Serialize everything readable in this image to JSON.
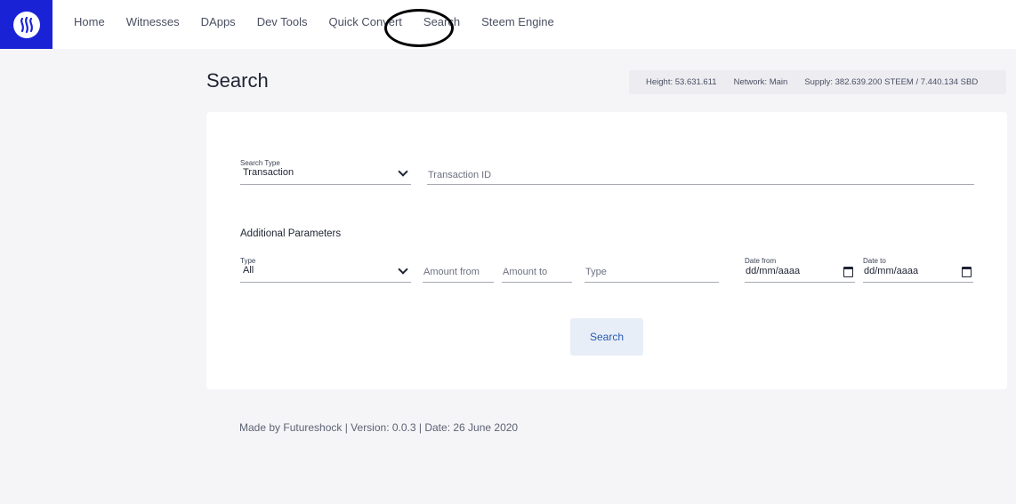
{
  "nav": {
    "items": [
      "Home",
      "Witnesses",
      "DApps",
      "Dev Tools",
      "Quick Convert",
      "Search",
      "Steem Engine"
    ],
    "active": "Search"
  },
  "page": {
    "title": "Search"
  },
  "stats": {
    "height": "Height: 53.631.611",
    "network": "Network: Main",
    "supply": "Supply: 382.639.200 STEEM / 7.440.134 SBD"
  },
  "form": {
    "search_type_label": "Search Type",
    "search_type_value": "Transaction",
    "transaction_id_placeholder": "Transaction ID",
    "additional_params_label": "Additional Parameters",
    "type_label": "Type",
    "type_value": "All",
    "amount_from_placeholder": "Amount from",
    "amount_to_placeholder": "Amount to",
    "type_text_placeholder": "Type",
    "date_from_label": "Date from",
    "date_from_value": "dd/mm/aaaa",
    "date_to_label": "Date to",
    "date_to_value": "dd/mm/aaaa",
    "search_button": "Search"
  },
  "footer": {
    "text": "Made by Futureshock |  Version: 0.0.3 | Date: 26 June 2020"
  },
  "colors": {
    "brand": "#1a22d6",
    "background": "#f5f5f8",
    "button_bg": "#e8eef7",
    "button_text": "#2a5bb5"
  },
  "icons": {
    "logo": "steem-logo-icon",
    "dropdown": "chevron-down-icon",
    "calendar": "calendar-icon"
  }
}
